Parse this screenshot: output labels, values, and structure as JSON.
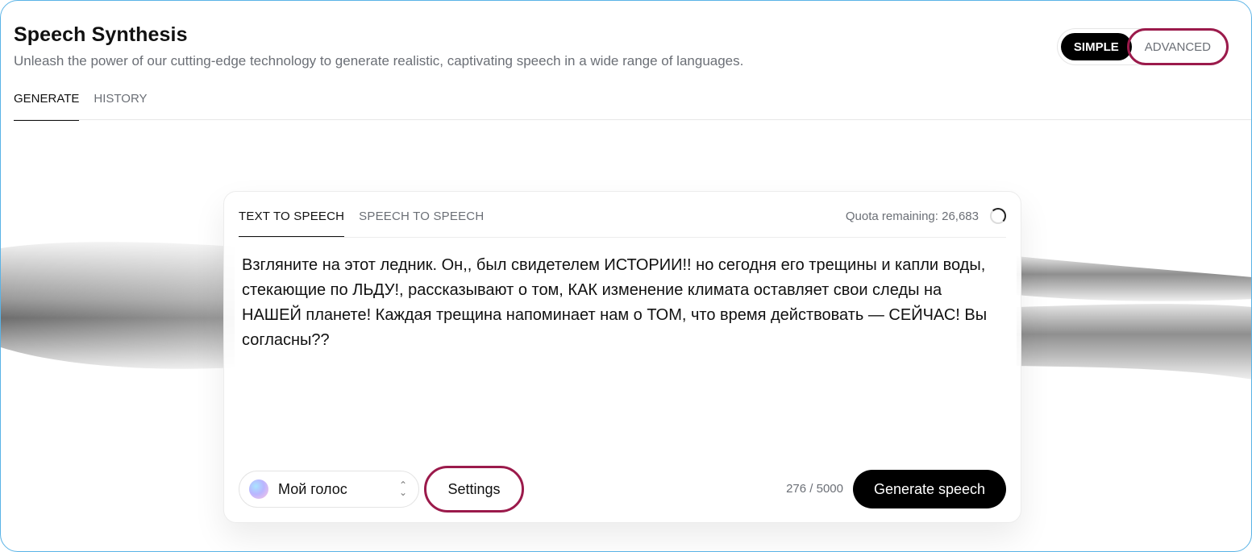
{
  "header": {
    "title": "Speech Synthesis",
    "subtitle": "Unleash the power of our cutting-edge technology to generate realistic, captivating speech in a wide range of languages."
  },
  "mode_toggle": {
    "simple_label": "SIMPLE",
    "advanced_label": "ADVANCED",
    "selected": "SIMPLE"
  },
  "tabs": [
    {
      "label": "GENERATE",
      "active": true
    },
    {
      "label": "HISTORY",
      "active": false
    }
  ],
  "card": {
    "tabs": [
      {
        "label": "TEXT TO SPEECH",
        "active": true
      },
      {
        "label": "SPEECH TO SPEECH",
        "active": false
      }
    ],
    "quota_text": "Quota remaining: 26,683",
    "text_value": "Взгляните на этот ледник. Он,, был свидетелем ИСТОРИИ!! но сегодня его трещины и капли воды, стекающие по ЛЬДУ!, рассказывают о том, КАК изменение климата оставляет свои следы на НАШЕЙ планете! Каждая трещина напоминает нам о ТОМ, что время действовать — СЕЙЧАС! Вы согласны??",
    "voice_label": "Мой голос",
    "settings_label": "Settings",
    "char_count": "276 / 5000",
    "generate_label": "Generate speech"
  },
  "icons": {
    "spinner": "loading-spinner-icon",
    "chevron": "chevron-updown-icon",
    "avatar": "voice-avatar-icon"
  },
  "colors": {
    "accent": "#000000",
    "highlight": "#9b1a4b",
    "frame": "#5ab3e6",
    "muted_text": "#6b6f76"
  }
}
